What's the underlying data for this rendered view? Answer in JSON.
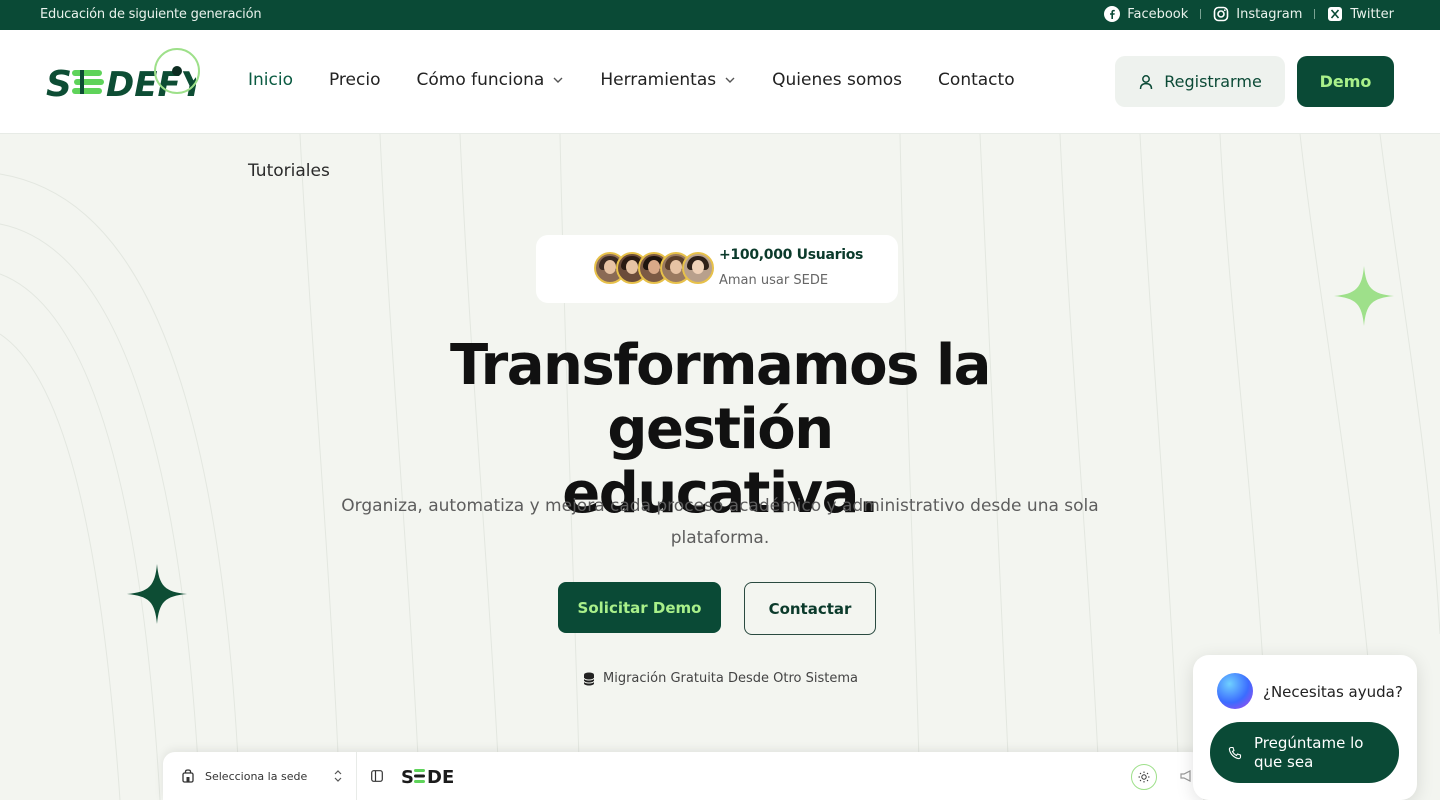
{
  "topbar": {
    "tagline": "Educación de siguiente generación",
    "social": [
      {
        "label": "Facebook",
        "icon": "facebook-icon"
      },
      {
        "label": "Instagram",
        "icon": "instagram-icon"
      },
      {
        "label": "Twitter",
        "icon": "x-twitter-icon"
      }
    ]
  },
  "header": {
    "logo_text": "SEDEFY",
    "nav": [
      {
        "label": "Inicio",
        "active": true
      },
      {
        "label": "Precio"
      },
      {
        "label": "Cómo funciona",
        "dropdown": true
      },
      {
        "label": "Herramientas",
        "dropdown": true
      },
      {
        "label": "Quienes somos"
      },
      {
        "label": "Contacto"
      }
    ],
    "nav_overflow": "Tutoriales",
    "register_label": "Registrarme",
    "demo_label": "Demo"
  },
  "hero": {
    "users_count": "+100,000 Usuarios",
    "users_sub": "Aman usar SEDE",
    "title_line1": "Transformamos la gestión",
    "title_line2": "educativa.",
    "subtitle": "Organiza, automatiza y mejora cada proceso académico y administrativo desde una sola plataforma.",
    "cta_primary": "Solicitar Demo",
    "cta_secondary": "Contactar",
    "migration_note": "Migración Gratuita Desde Otro Sistema"
  },
  "preview": {
    "select_label": "Selecciona la sede",
    "brand": "SEDE"
  },
  "help_widget": {
    "question": "¿Necesitas ayuda?",
    "button_label": "Pregúntame lo que sea"
  },
  "colors": {
    "brand_dark": "#0a4a36",
    "brand_accent": "#a9f08a",
    "background": "#f3f5f0"
  }
}
